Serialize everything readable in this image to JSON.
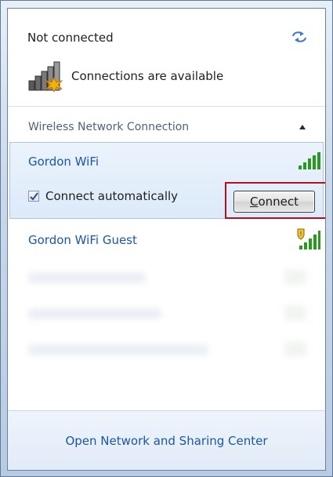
{
  "status": {
    "title": "Not connected",
    "refresh_icon": "refresh-arrows-icon",
    "availability": "Connections are available",
    "availability_icon": "signal-bars-star-icon"
  },
  "section": {
    "label": "Wireless Network Connection",
    "collapse_icon": "chevron-up-icon"
  },
  "networks": [
    {
      "name": "Gordon WiFi",
      "signal_icon": "signal-strength-icon",
      "selected": true,
      "connect_automatically_label": "Connect automatically",
      "connect_automatically_checked": true,
      "connect_label_prefix": "",
      "connect_label_underlined": "C",
      "connect_label_rest": "onnect"
    },
    {
      "name": "Gordon WiFi Guest",
      "signal_icon": "secured-signal-shield-icon",
      "selected": false
    }
  ],
  "footer": {
    "link": "Open Network and Sharing Center"
  },
  "colors": {
    "link_blue": "#1a56a8",
    "highlight_red": "#b2101e",
    "signal_green": "#2a9a1e"
  }
}
